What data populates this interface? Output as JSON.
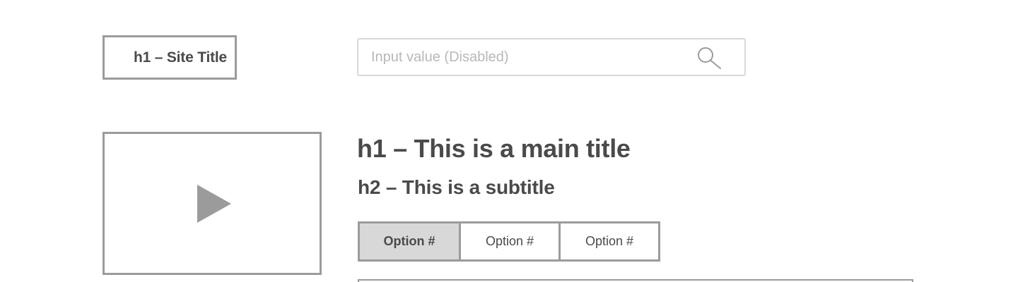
{
  "header": {
    "site_title": "h1 – Site Title",
    "search": {
      "placeholder": "Input value (Disabled)",
      "value": "",
      "icon": "search-icon"
    }
  },
  "media": {
    "icon": "play-icon"
  },
  "content": {
    "main_title": "h1 – This is a main title",
    "subtitle": "h2 – This is a subtitle"
  },
  "options": {
    "items": [
      {
        "label": "Option #",
        "selected": true
      },
      {
        "label": "Option #",
        "selected": false
      },
      {
        "label": "Option #",
        "selected": false
      }
    ]
  },
  "colors": {
    "border": "#9b9b9b",
    "text": "#4a4a4a",
    "selected_bg": "#d8d8d8",
    "placeholder": "#b8b8b8"
  }
}
